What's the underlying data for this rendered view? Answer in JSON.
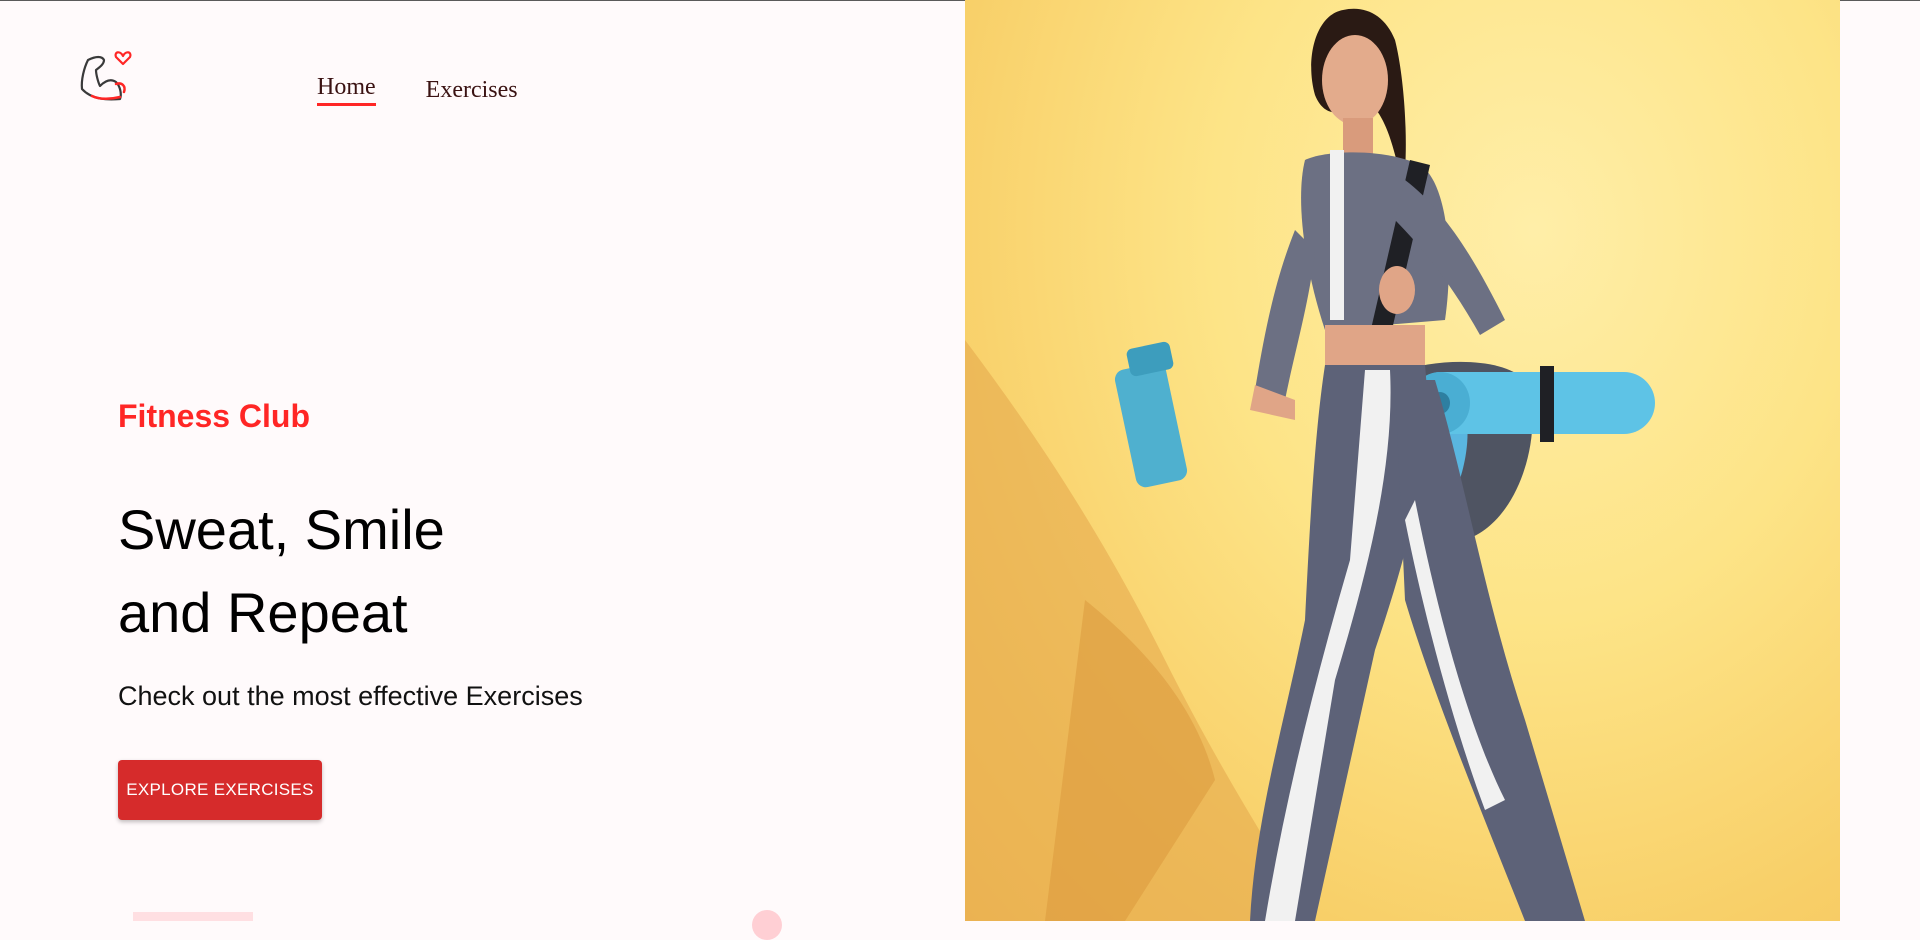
{
  "nav": {
    "items": [
      {
        "label": "Home",
        "active": true
      },
      {
        "label": "Exercises",
        "active": false
      }
    ]
  },
  "hero": {
    "eyebrow": "Fitness Club",
    "headline_line1": "Sweat, Smile",
    "headline_line2": "and Repeat",
    "subline": "Check out the most effective Exercises",
    "cta_label": "EXPLORE EXERCISES"
  },
  "colors": {
    "accent": "#ff2625",
    "button": "#d62b2b",
    "background": "#fffafb",
    "photo_bg": "#fde487"
  },
  "icons": {
    "logo": "flexed-arm-heart-icon"
  }
}
